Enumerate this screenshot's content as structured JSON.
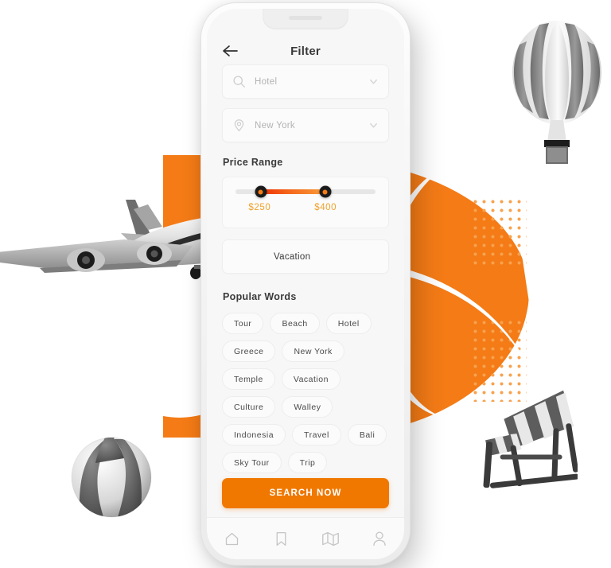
{
  "app": {
    "screen_title": "Filter",
    "back_icon": "arrow-left-icon"
  },
  "fields": [
    {
      "icon": "search-icon",
      "value": "Hotel",
      "placeholder": "Hotel",
      "caret": "chevron-down-icon"
    },
    {
      "icon": "location-icon",
      "value": "New York",
      "placeholder": "New York",
      "caret": "chevron-down-icon"
    },
    {
      "icon": "none",
      "value": "Vacation",
      "placeholder": "Vacation",
      "caret": "none"
    }
  ],
  "price_range": {
    "label": "Price Range",
    "min_label": "$250",
    "max_label": "$400",
    "min_value": 250,
    "max_value": 400,
    "track_color": "#e6e6e6",
    "fill_gradient_start": "#ef2f06",
    "fill_gradient_end": "#f99d3a",
    "label_color": "#f0a12b"
  },
  "popular_words": {
    "label": "Popular Words",
    "tags": [
      "Tour",
      "Beach",
      "Hotel",
      "Greece",
      "New York",
      "Temple",
      "Vacation",
      "Culture",
      "Walley",
      "Indonesia",
      "Travel",
      "Bali",
      "Sky Tour",
      "Trip"
    ]
  },
  "search_button": {
    "label": "SEARCH NOW",
    "color": "#F07800"
  },
  "tabbar": {
    "items": [
      {
        "name": "home-icon"
      },
      {
        "name": "bookmark-icon"
      },
      {
        "name": "map-icon"
      },
      {
        "name": "profile-icon"
      }
    ]
  },
  "decor": {
    "accent_color": "#F47B16",
    "objects": [
      "hot-air-balloon",
      "airplane",
      "beach-ball",
      "deck-chair"
    ]
  }
}
